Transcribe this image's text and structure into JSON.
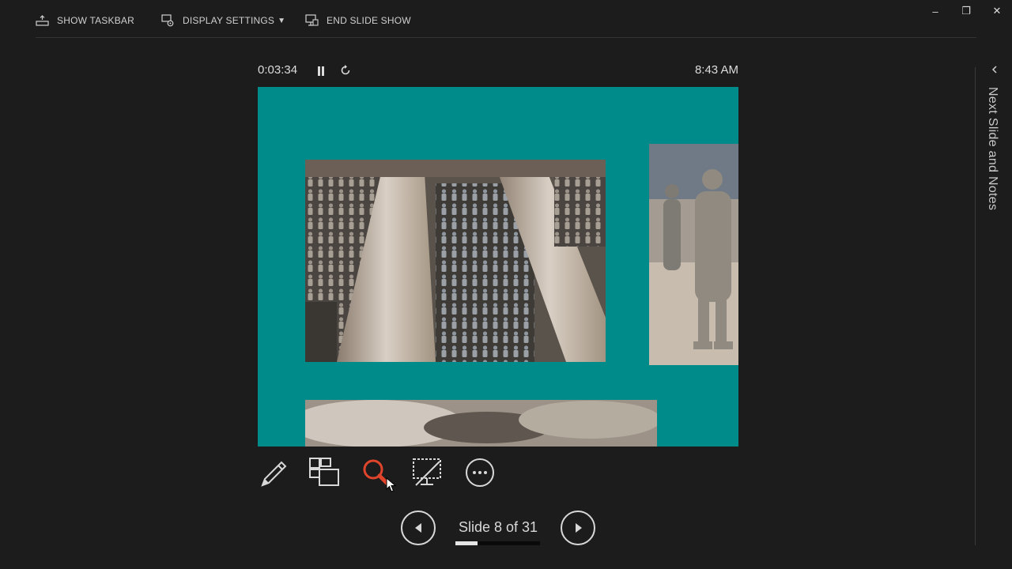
{
  "toolbar": {
    "show_taskbar": "SHOW TASKBAR",
    "display_settings": "DISPLAY SETTINGS",
    "end_slide_show": "END SLIDE SHOW"
  },
  "window_controls": {
    "minimize": "–",
    "restore": "❐",
    "close": "✕"
  },
  "presenter": {
    "elapsed_time": "0:03:34",
    "clock": "8:43 AM",
    "slide_counter": "Slide 8 of 31",
    "current_slide": 8,
    "total_slides": 31
  },
  "right_panel": {
    "label": "Next Slide and Notes"
  },
  "colors": {
    "background": "#1c1c1c",
    "slide_background": "#008b8b",
    "zoom_tool_active": "#e0452b"
  },
  "icons": {
    "show_taskbar": "taskbar-icon",
    "display_settings": "display-settings-icon",
    "end_slide_show": "end-show-icon",
    "pause": "pause-icon",
    "reset": "reset-timer-icon",
    "pen": "pen-icon",
    "see_all_slides": "grid-slides-icon",
    "zoom": "zoom-magnifier-icon",
    "black_screen": "black-screen-icon",
    "more": "more-options-icon",
    "previous": "previous-arrow-icon",
    "next": "next-arrow-icon"
  }
}
